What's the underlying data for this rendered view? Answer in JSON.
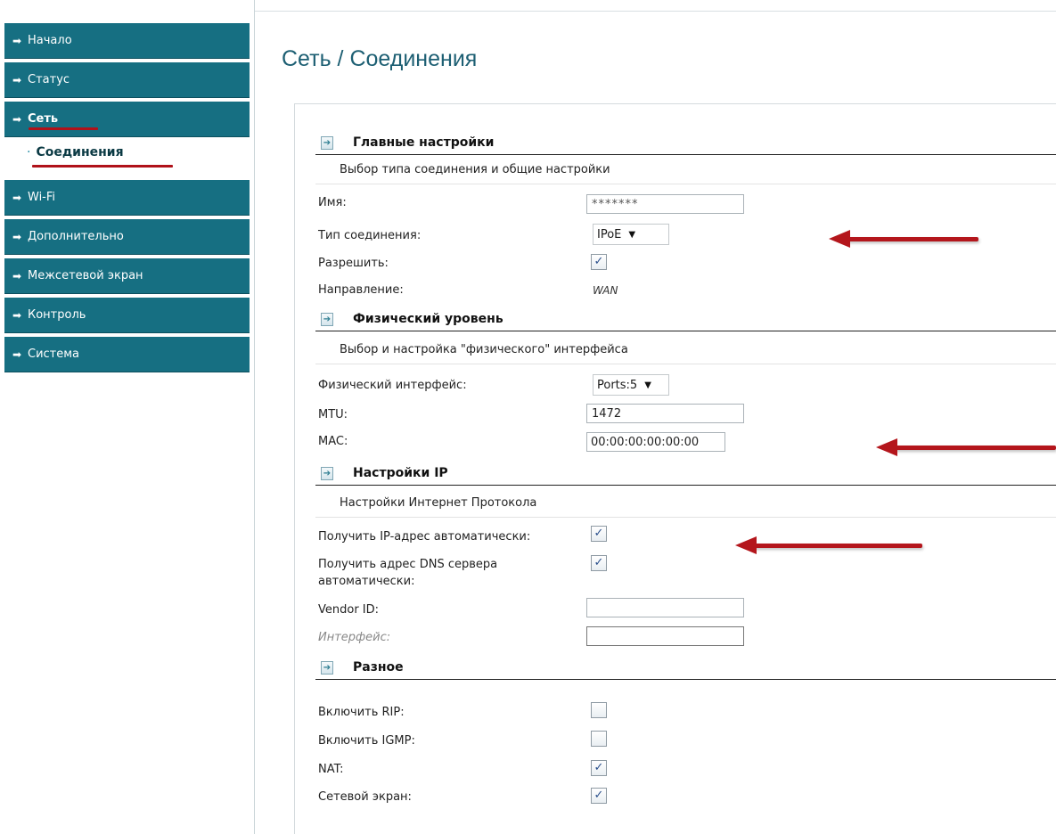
{
  "sidebar": {
    "items": [
      {
        "label": "Начало"
      },
      {
        "label": "Статус"
      },
      {
        "label": "Сеть"
      },
      {
        "label": "Wi-Fi"
      },
      {
        "label": "Дополнительно"
      },
      {
        "label": "Межсетевой экран"
      },
      {
        "label": "Контроль"
      },
      {
        "label": "Система"
      }
    ],
    "subitem": "Соединения",
    "arrow_glyph": "➡"
  },
  "page": {
    "title": "Сеть  /  Соединения"
  },
  "sections": {
    "main": {
      "title": "Главные настройки",
      "desc": "Выбор типа соединения и общие настройки",
      "name_label": "Имя:",
      "name_value": "*******",
      "type_label": "Тип соединения:",
      "type_value": "IPoE",
      "enable_label": "Разрешить:",
      "direction_label": "Направление:",
      "direction_value": "WAN"
    },
    "physical": {
      "title": "Физический уровень",
      "desc": "Выбор и настройка \"физического\" интерфейса",
      "iface_label": "Физический интерфейс:",
      "iface_value": "Ports:5",
      "mtu_label": "MTU:",
      "mtu_value": "1472",
      "mac_label": "MAC:",
      "mac_value": "00:00:00:00:00:00"
    },
    "ip": {
      "title": "Настройки IP",
      "desc": "Настройки Интернет Протокола",
      "auto_ip_label": "Получить IP-адрес автоматически:",
      "auto_dns_label_1": "Получить адрес DNS сервера",
      "auto_dns_label_2": "автоматически:",
      "vendor_label": "Vendor ID:",
      "vendor_value": "",
      "iface_label": "Интерфейс:",
      "iface_value": ""
    },
    "misc": {
      "title": "Разное",
      "rip_label": "Включить RIP:",
      "igmp_label": "Включить IGMP:",
      "nat_label": "NAT:",
      "firewall_label": "Сетевой экран:"
    }
  },
  "checkboxes": {
    "enable": true,
    "auto_ip": true,
    "auto_dns": true,
    "rip": false,
    "igmp": false,
    "nat": true,
    "firewall": true
  },
  "colors": {
    "nav_bg": "#166f82",
    "title": "#1d5f73",
    "annotation_red": "#b4161c"
  }
}
